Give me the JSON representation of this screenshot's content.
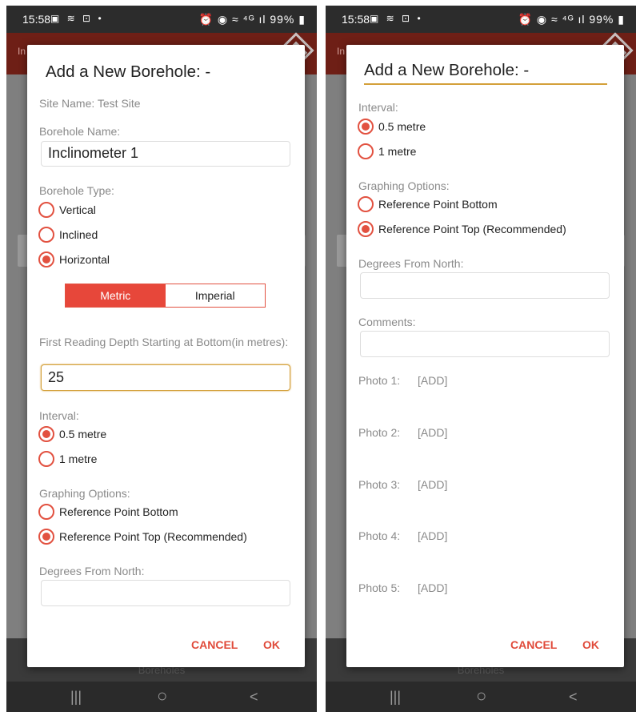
{
  "status": {
    "time": "15:58",
    "battery": "99%",
    "left_icons": "▣ ≋ ⊡ •",
    "right_icons": "⏰ ◉ ≈ ⁴ᴳ ıl"
  },
  "appbar": {
    "title_fragment": "In"
  },
  "bottom_tab": {
    "label": "Boreholes"
  },
  "nav": {
    "recents": "|||",
    "home": "○",
    "back": "<"
  },
  "dialog": {
    "title": "Add a New Borehole: -",
    "site_name_label": "Site Name:",
    "site_name_value": "Test Site",
    "borehole_name_label": "Borehole Name:",
    "borehole_name_value": "Inclinometer 1",
    "borehole_type_label": "Borehole Type:",
    "borehole_types": [
      {
        "label": "Vertical",
        "selected": false
      },
      {
        "label": "Inclined",
        "selected": false
      },
      {
        "label": "Horizontal",
        "selected": true
      }
    ],
    "units": [
      "Metric",
      "Imperial"
    ],
    "selected_unit": "Metric",
    "first_reading_label": "First Reading Depth Starting at Bottom(in metres):",
    "first_reading_value": "25",
    "interval_label": "Interval:",
    "intervals": [
      {
        "label": "0.5 metre",
        "selected": true
      },
      {
        "label": "1 metre",
        "selected": false
      }
    ],
    "graphing_label": "Graphing Options:",
    "graphing_options": [
      {
        "label": "Reference Point Bottom",
        "selected": false
      },
      {
        "label": "Reference Point Top (Recommended)",
        "selected": true
      }
    ],
    "degrees_label": "Degrees From North:",
    "degrees_value": "",
    "comments_label": "Comments:",
    "comments_value": "",
    "photos": [
      {
        "label": "Photo 1:",
        "action": "[ADD]"
      },
      {
        "label": "Photo 2:",
        "action": "[ADD]"
      },
      {
        "label": "Photo 3:",
        "action": "[ADD]"
      },
      {
        "label": "Photo 4:",
        "action": "[ADD]"
      },
      {
        "label": "Photo 5:",
        "action": "[ADD]"
      }
    ],
    "cancel_label": "CANCEL",
    "ok_label": "OK"
  },
  "colors": {
    "accent": "#e25140",
    "focus": "#d4a03a",
    "appbar": "#6e1f16",
    "scrim": "#7f7f7f"
  }
}
